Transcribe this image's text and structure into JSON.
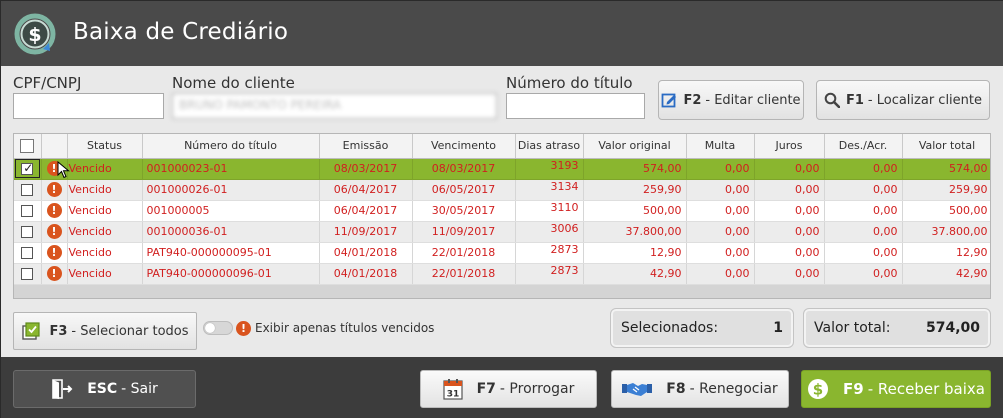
{
  "window": {
    "title": "Baixa de Crediário"
  },
  "filters": {
    "cpf_label": "CPF/CNPJ",
    "cpf_value": "",
    "name_label": "Nome do cliente",
    "name_value": "BRUNO PAMONTO PEREIRA",
    "title_number_label": "Número do título",
    "title_number_value": ""
  },
  "actions": {
    "edit_client": {
      "key": "F2",
      "label": "- Editar cliente"
    },
    "find_client": {
      "key": "F1",
      "label": "- Localizar cliente"
    }
  },
  "table": {
    "columns": [
      "Status",
      "Número do título",
      "Emissão",
      "Vencimento",
      "Dias atraso",
      "Valor original",
      "Multa",
      "Juros",
      "Des./Acr.",
      "Valor total"
    ],
    "rows": [
      {
        "status": "Vencido",
        "numero": "001000023-01",
        "emissao": "08/03/2017",
        "vencimento": "08/03/2017",
        "dias": "3193",
        "valor_original": "574,00",
        "multa": "0,00",
        "juros": "0,00",
        "desacr": "0,00",
        "valor_total": "574,00",
        "checked": true
      },
      {
        "status": "Vencido",
        "numero": "001000026-01",
        "emissao": "06/04/2017",
        "vencimento": "06/05/2017",
        "dias": "3134",
        "valor_original": "259,90",
        "multa": "0,00",
        "juros": "0,00",
        "desacr": "0,00",
        "valor_total": "259,90",
        "checked": false
      },
      {
        "status": "Vencido",
        "numero": "001000005",
        "emissao": "06/04/2017",
        "vencimento": "30/05/2017",
        "dias": "3110",
        "valor_original": "500,00",
        "multa": "0,00",
        "juros": "0,00",
        "desacr": "0,00",
        "valor_total": "500,00",
        "checked": false
      },
      {
        "status": "Vencido",
        "numero": "001000036-01",
        "emissao": "11/09/2017",
        "vencimento": "11/09/2017",
        "dias": "3006",
        "valor_original": "37.800,00",
        "multa": "0,00",
        "juros": "0,00",
        "desacr": "0,00",
        "valor_total": "37.800,00",
        "checked": false
      },
      {
        "status": "Vencido",
        "numero": "PAT940-000000095-01",
        "emissao": "04/01/2018",
        "vencimento": "22/01/2018",
        "dias": "2873",
        "valor_original": "12,90",
        "multa": "0,00",
        "juros": "0,00",
        "desacr": "0,00",
        "valor_total": "12,90",
        "checked": false
      },
      {
        "status": "Vencido",
        "numero": "PAT940-000000096-01",
        "emissao": "04/01/2018",
        "vencimento": "22/01/2018",
        "dias": "2873",
        "valor_original": "42,90",
        "multa": "0,00",
        "juros": "0,00",
        "desacr": "0,00",
        "valor_total": "42,90",
        "checked": false
      }
    ]
  },
  "bottom": {
    "select_all": {
      "key": "F3",
      "label": "- Selecionar todos"
    },
    "only_overdue_label": "Exibir apenas títulos vencidos",
    "selected_label": "Selecionados:",
    "selected_count": "1",
    "total_label": "Valor total:",
    "total_value": "574,00"
  },
  "footer": {
    "exit": {
      "key": "ESC",
      "label": "- Sair"
    },
    "extend": {
      "key": "F7",
      "label": "- Prorrogar",
      "calendar_day": "31"
    },
    "renegotiate": {
      "key": "F8",
      "label": "- Renegociar"
    },
    "receive": {
      "key": "F9",
      "label": "- Receber baixa"
    }
  },
  "colors": {
    "header_bg": "#4a4a4a",
    "accent_green": "#8ab62f",
    "overdue_red": "#d11f1f",
    "warning_orange": "#d9541e"
  }
}
